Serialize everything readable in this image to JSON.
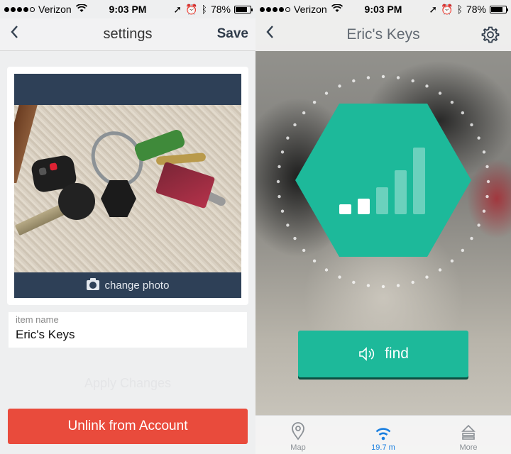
{
  "status_bar": {
    "carrier": "Verizon",
    "time": "9:03 PM",
    "battery": "78%",
    "battery_level": 0.78,
    "signal_bars_filled": 4,
    "signal_bars_total": 5
  },
  "settings_screen": {
    "title": "settings",
    "save_label": "Save",
    "change_photo_label": "change photo",
    "item_name_label": "item name",
    "item_name_value": "Eric's Keys",
    "apply_label": "Apply Changes",
    "unlink_label": "Unlink from Account"
  },
  "find_screen": {
    "title": "Eric's Keys",
    "find_label": "find",
    "signal_strength_bars": 2,
    "signal_total_bars": 5,
    "tabs": [
      {
        "label": "Map",
        "icon": "map-pin-icon",
        "active": false
      },
      {
        "label": "19.7 m",
        "icon": "wifi-icon",
        "active": true
      },
      {
        "label": "More",
        "icon": "stack-icon",
        "active": false
      }
    ]
  },
  "colors": {
    "accent_teal": "#1db99a",
    "danger_red": "#e94b3c",
    "navy": "#2e4057",
    "tab_active_blue": "#1a7fe0"
  }
}
